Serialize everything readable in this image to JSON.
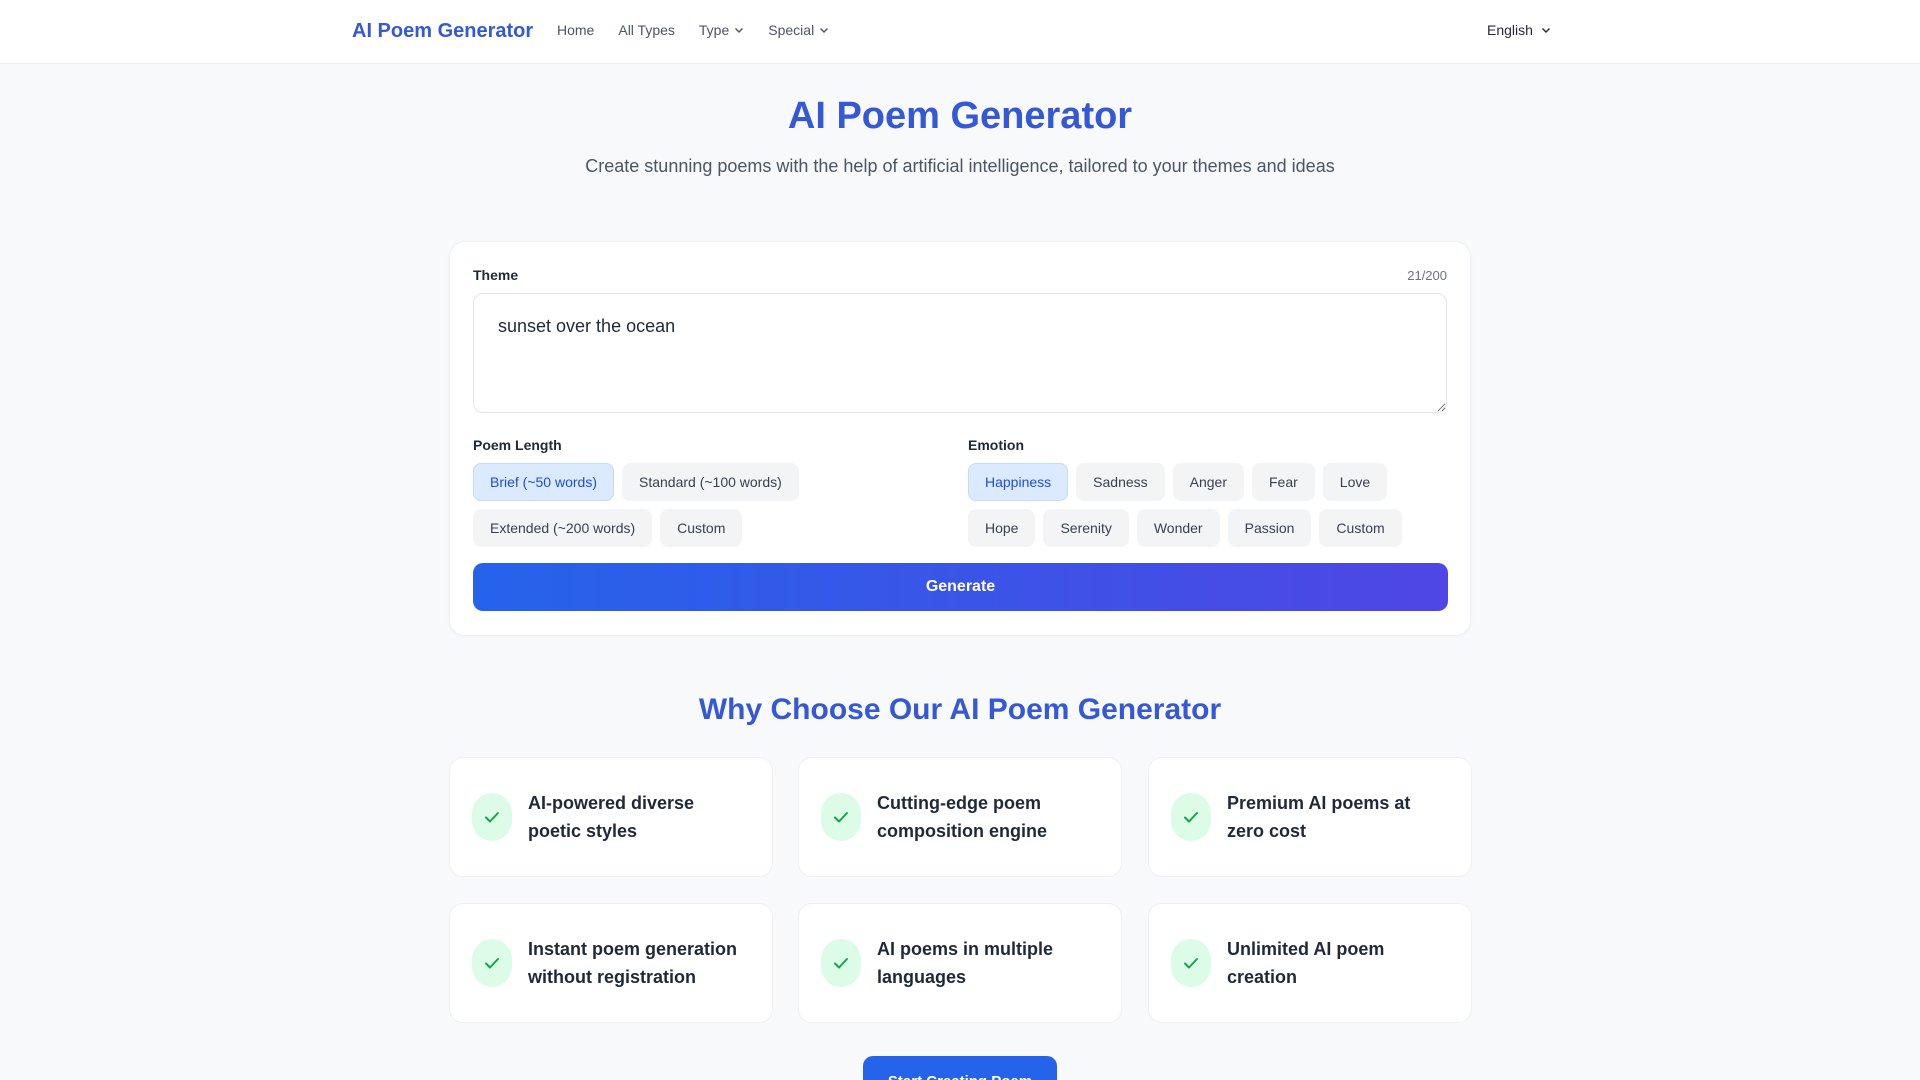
{
  "nav": {
    "brand": "AI Poem Generator",
    "links": [
      "Home",
      "All Types",
      "Type",
      "Special"
    ],
    "language": "English"
  },
  "hero": {
    "title": "AI Poem Generator",
    "subtitle": "Create stunning poems with the help of artificial intelligence, tailored to your themes and ideas"
  },
  "form": {
    "theme_label": "Theme",
    "theme_value": "sunset over the ocean",
    "counter": "21/200",
    "length_label": "Poem Length",
    "length_options": [
      "Brief (~50 words)",
      "Standard (~100 words)",
      "Extended (~200 words)",
      "Custom"
    ],
    "length_selected": "Brief (~50 words)",
    "emotion_label": "Emotion",
    "emotion_options": [
      "Happiness",
      "Sadness",
      "Anger",
      "Fear",
      "Love",
      "Hope",
      "Serenity",
      "Wonder",
      "Passion",
      "Custom"
    ],
    "emotion_selected": "Happiness",
    "generate_label": "Generate"
  },
  "why": {
    "title": "Why Choose Our AI Poem Generator",
    "features": [
      "AI-powered diverse poetic styles",
      "Cutting-edge poem composition engine",
      "Premium AI poems at zero cost",
      "Instant poem generation without registration",
      "AI poems in multiple languages",
      "Unlimited AI poem creation"
    ]
  },
  "cta_label": "Start Creating Poem",
  "colors": {
    "brand": "#3558d6",
    "chip_active_bg": "#dbeafe",
    "check_bg": "#dcfce7",
    "check_icon": "#16a34a"
  }
}
